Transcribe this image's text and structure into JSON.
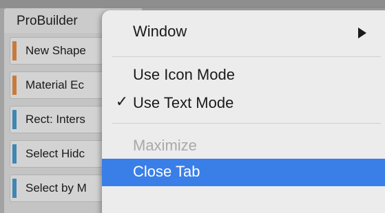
{
  "panel": {
    "tab_title": "ProBuilder",
    "buttons": [
      {
        "label": "New Shape",
        "color": "#c77b3e",
        "icon": "orange-category-bar"
      },
      {
        "label": "Material Ec",
        "color": "#c77b3e",
        "icon": "orange-category-bar"
      },
      {
        "label": "Rect: Inters",
        "color": "#3f86b3",
        "icon": "blue-category-bar"
      },
      {
        "label": "Select Hidc",
        "color": "#3f86b3",
        "icon": "blue-category-bar"
      },
      {
        "label": "Select by M",
        "color": "#3f86b3",
        "icon": "blue-category-bar"
      }
    ]
  },
  "menu": {
    "items": [
      {
        "label": "Window",
        "state": "normal",
        "checked": false,
        "submenu": true
      },
      {
        "label": "Use Icon Mode",
        "state": "normal",
        "checked": false,
        "submenu": false
      },
      {
        "label": "Use Text Mode",
        "state": "normal",
        "checked": true,
        "submenu": false
      },
      {
        "label": "Maximize",
        "state": "disabled",
        "checked": false,
        "submenu": false
      },
      {
        "label": "Close Tab",
        "state": "highlighted",
        "checked": false,
        "submenu": false
      }
    ],
    "check_glyph": "✓",
    "highlight_color": "#3a7ee8"
  }
}
